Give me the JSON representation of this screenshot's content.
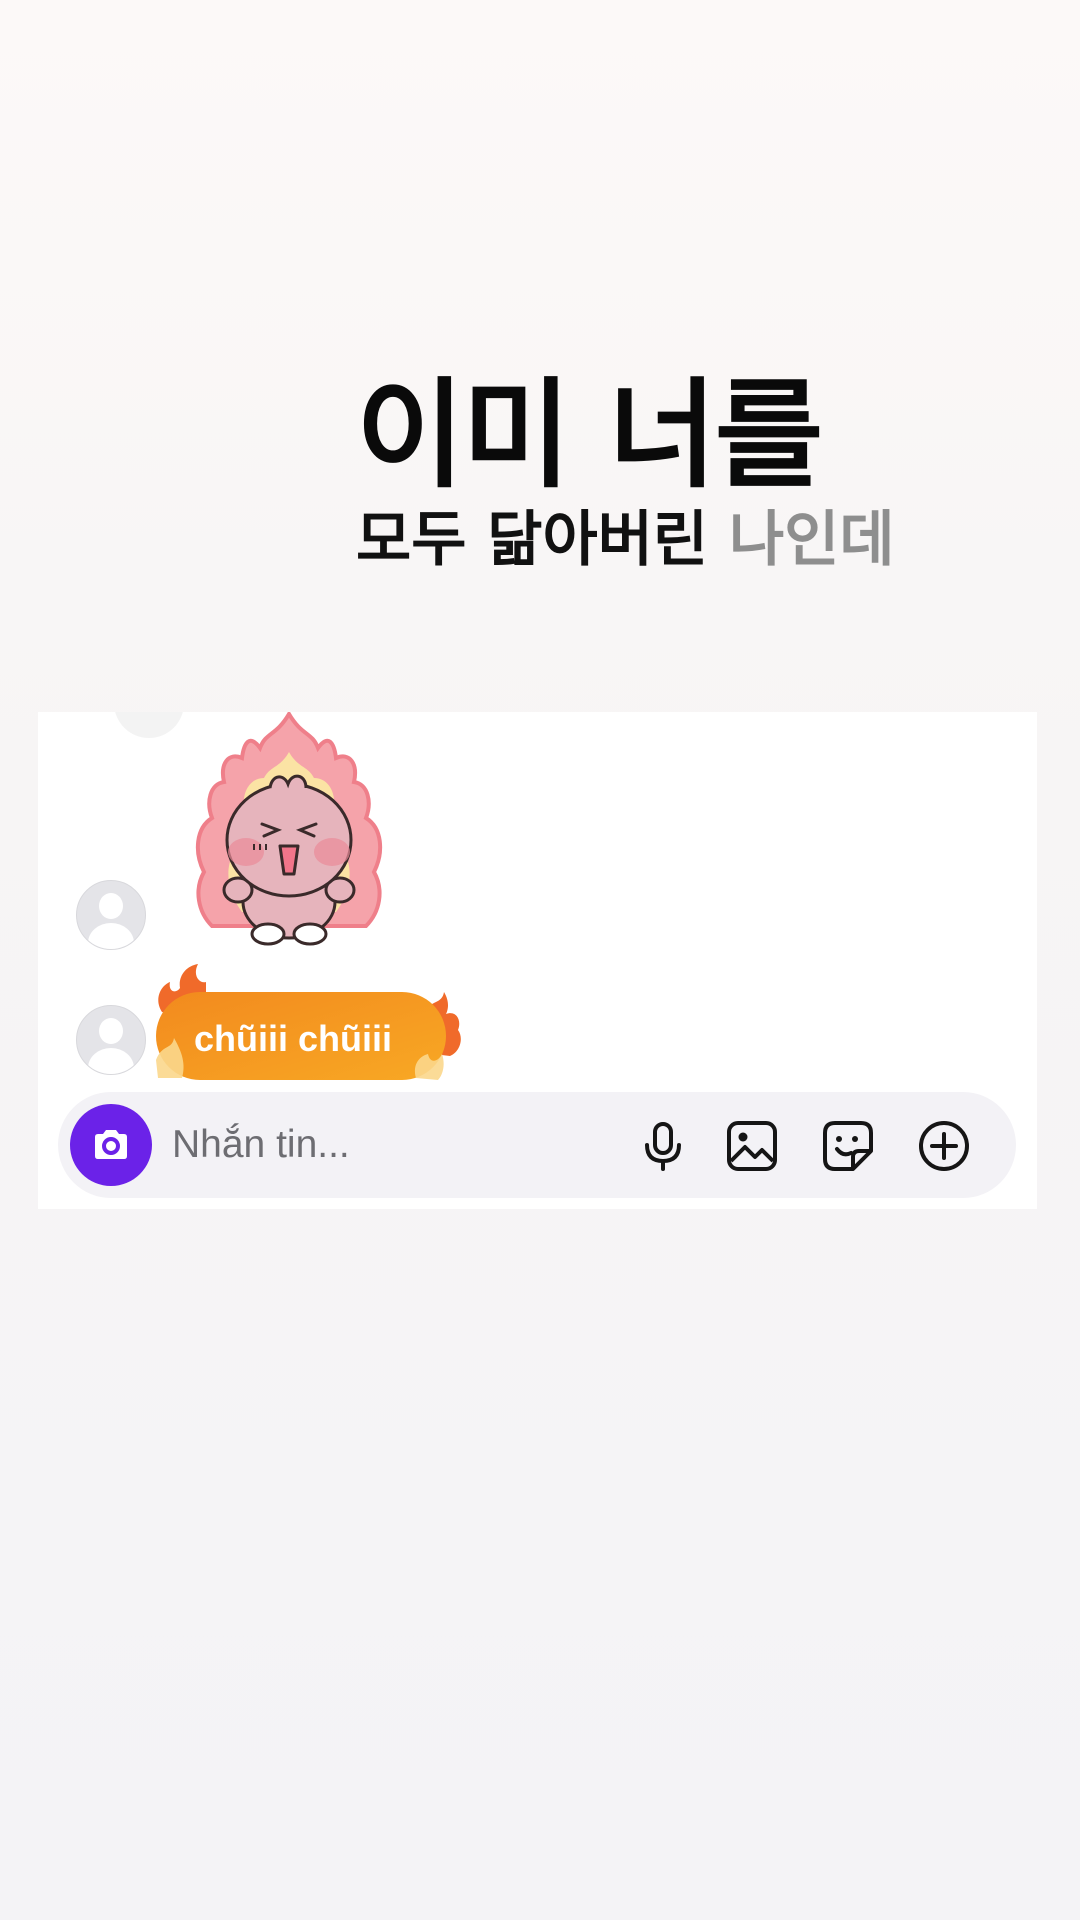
{
  "lyrics": {
    "line1": "이미 너를",
    "line2_main": "모두 닮아버린",
    "line2_faded": "나인데"
  },
  "chat": {
    "messages": [
      {
        "type": "sticker",
        "sticker_name": "angry-bunny-on-fire-sticker"
      },
      {
        "type": "text",
        "text": "chũiii chũiii",
        "style": "fire-bubble"
      }
    ],
    "composer": {
      "placeholder": "Nhắn tin...",
      "icons": [
        "camera-icon",
        "microphone-icon",
        "image-icon",
        "sticker-icon",
        "plus-circle-icon"
      ],
      "camera_button_color": "#6b22e8"
    }
  },
  "colors": {
    "bubble_gradient_start": "#f59a1c",
    "bubble_gradient_end": "#f7a623",
    "flame_outer": "#f06a2a",
    "sticker_flame": "#f49aa2",
    "sticker_body": "#e8b7bf"
  }
}
